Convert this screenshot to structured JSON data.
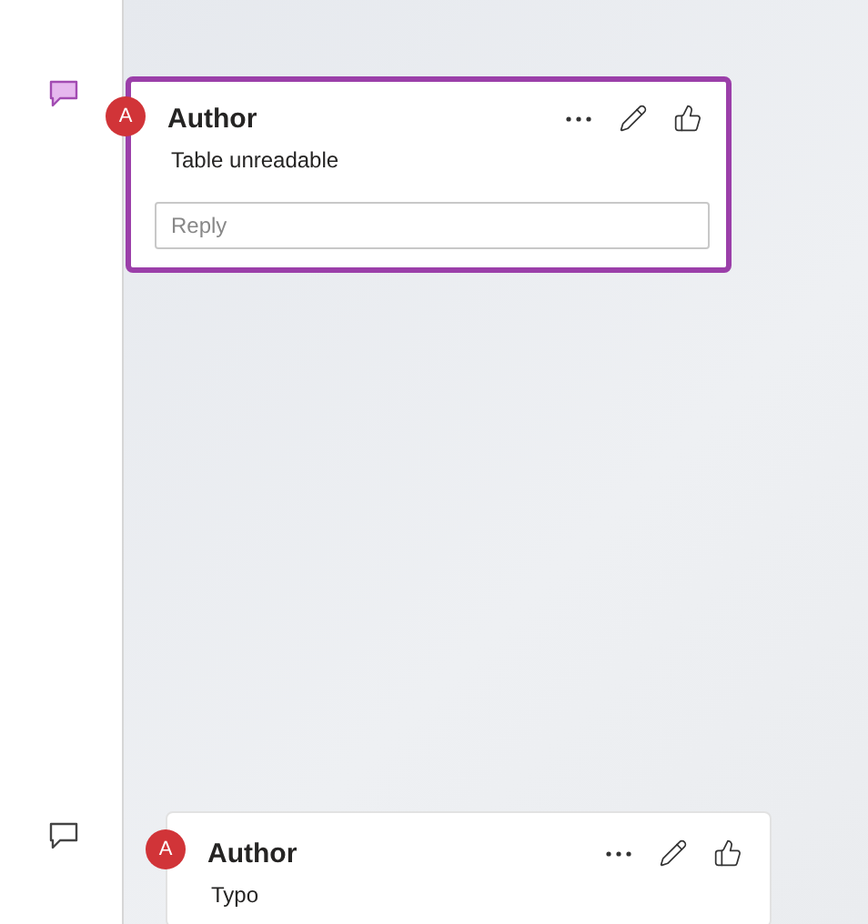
{
  "comments": [
    {
      "author": "Author",
      "avatar": "A",
      "text": "Table unreadable",
      "reply": {
        "placeholder": "Reply"
      },
      "selected": true
    },
    {
      "author": "Author",
      "avatar": "A",
      "text": "Typo",
      "selected": false
    }
  ]
}
